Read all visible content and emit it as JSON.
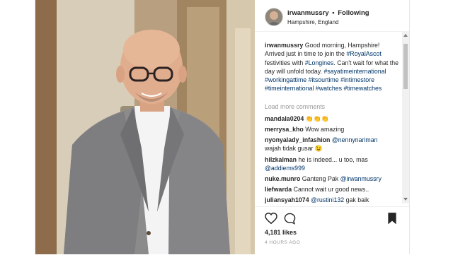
{
  "header": {
    "username": "irwanmussry",
    "separator": "•",
    "follow_label": "Following",
    "location": "Hampshire, England"
  },
  "caption": {
    "author": "irwanmussry",
    "text_before": " Good morning, Hampshire! Arrived just in time to join the ",
    "tag_royal": "#RoyalAscot",
    "text_mid": " festivities with ",
    "mention_longines": "#Longines",
    "text_after": ". Can't wait for what the day will unfold today. ",
    "hashtags": "#sayatimeinternational #workingattime #itsourtime #intimestore #timeinternational #watches #timewatches"
  },
  "load_more": "Load more comments",
  "comments": [
    {
      "user": "mandala0204",
      "text": " 👏👏👏"
    },
    {
      "user": "merrysa_kho",
      "text": " Wow amazing"
    },
    {
      "user": "nyonyalady_infashion",
      "text": " ",
      "mention": "@nennynariman"
    },
    {
      "user": "",
      "text": "wajah tidak gusar 😉"
    },
    {
      "user": "hilzkalman",
      "text": " he is indeed... u too, mas"
    },
    {
      "user": "",
      "text": "",
      "mention": "@addiems999"
    },
    {
      "user": "nuke.munro",
      "text": " Ganteng Pak ",
      "mention": "@irwanmussry"
    },
    {
      "user": "liefwarda",
      "text": " Cannot wait ur good news.."
    },
    {
      "user": "juliansyah1074",
      "text": " ",
      "mention": "@rustini132",
      "text2": " gak baik"
    }
  ],
  "likes": "4,181 likes",
  "time_ago": "4 HOURS AGO",
  "icons": {
    "like": "heart-icon",
    "comment": "speech-bubble-icon",
    "save": "bookmark-icon"
  }
}
